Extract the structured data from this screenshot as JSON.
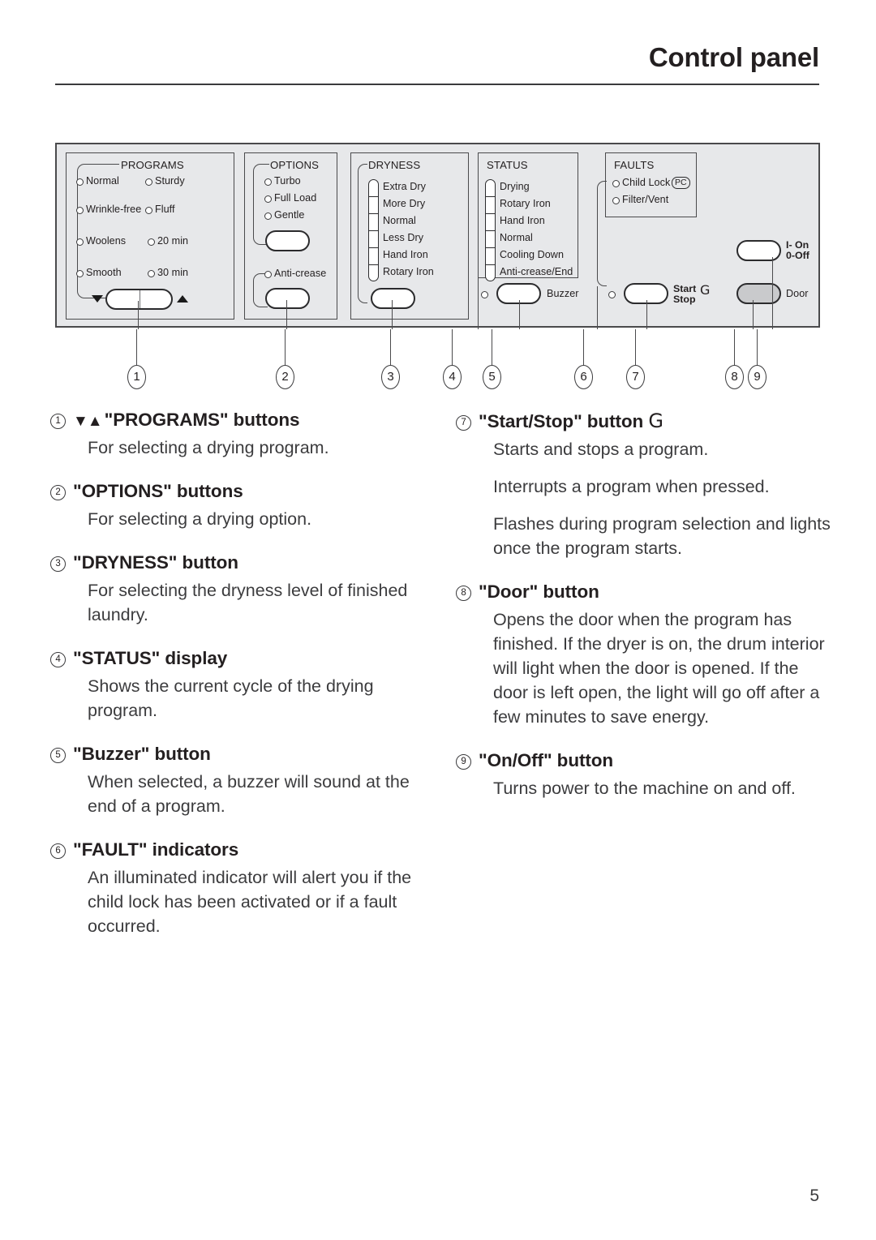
{
  "header": {
    "title": "Control panel"
  },
  "page_number": "5",
  "panel": {
    "groups": {
      "programs": {
        "title": "PROGRAMS",
        "left_column": [
          "Normal",
          "Wrinkle-free",
          "Woolens",
          "Smooth"
        ],
        "right_column": [
          "Sturdy",
          "Fluff",
          "20 min",
          "30 min"
        ],
        "down_arrow": "▼",
        "up_arrow": "▲"
      },
      "options": {
        "title": "OPTIONS",
        "items": [
          "Turbo",
          "Full Load",
          "Gentle"
        ],
        "secondary_item": "Anti-crease"
      },
      "dryness": {
        "title": "DRYNESS",
        "levels": [
          "Extra Dry",
          "More Dry",
          "Normal",
          "Less Dry",
          "Hand Iron",
          "Rotary Iron"
        ]
      },
      "status": {
        "title": "STATUS",
        "levels": [
          "Drying",
          "Rotary Iron",
          "Hand Iron",
          "Normal",
          "Cooling Down",
          "Anti-crease/End"
        ]
      },
      "faults": {
        "title": "FAULTS",
        "items": [
          "Child Lock",
          "Filter/Vent"
        ],
        "child_lock_badge": "PC"
      }
    },
    "buttons": {
      "buzzer_label": "Buzzer",
      "start_stop_line1": "Start",
      "start_stop_line2": "Stop",
      "start_stop_glyph": "G",
      "power_line1": "I- On",
      "power_line2": "0-Off",
      "door_label": "Door"
    },
    "callouts": [
      "1",
      "2",
      "3",
      "4",
      "5",
      "6",
      "7",
      "8",
      "9"
    ]
  },
  "left_column": [
    {
      "num": "1",
      "arrows": "▼▲",
      "title": "\"PROGRAMS\" buttons",
      "paragraphs": [
        "For selecting a drying program."
      ]
    },
    {
      "num": "2",
      "title": "\"OPTIONS\" buttons",
      "paragraphs": [
        "For selecting a drying option."
      ]
    },
    {
      "num": "3",
      "title": "\"DRYNESS\" button",
      "paragraphs": [
        "For selecting the dryness level of finished laundry."
      ]
    },
    {
      "num": "4",
      "title": "\"STATUS\" display",
      "paragraphs": [
        "Shows the current cycle of the drying program."
      ]
    },
    {
      "num": "5",
      "title": "\"Buzzer\" button",
      "paragraphs": [
        "When selected, a buzzer will sound at the end of a program."
      ]
    },
    {
      "num": "6",
      "title": "\"FAULT\" indicators",
      "paragraphs": [
        "An illuminated indicator will alert you if the child lock has been activated or if a fault occurred."
      ]
    }
  ],
  "right_column": [
    {
      "num": "7",
      "title": "\"Start/Stop\" button",
      "glyph": "G",
      "paragraphs": [
        "Starts and stops a program.",
        "Interrupts a program when pressed.",
        "Flashes during program selection and lights once the program starts."
      ]
    },
    {
      "num": "8",
      "title": "\"Door\" button",
      "paragraphs": [
        "Opens the door when the program has finished. If the dryer is on, the drum interior will light when the door is opened. If the door is left open, the light will go off after a few minutes to save energy."
      ]
    },
    {
      "num": "9",
      "title": "\"On/Off\" button",
      "paragraphs": [
        "Turns power to the machine on and off."
      ]
    }
  ]
}
